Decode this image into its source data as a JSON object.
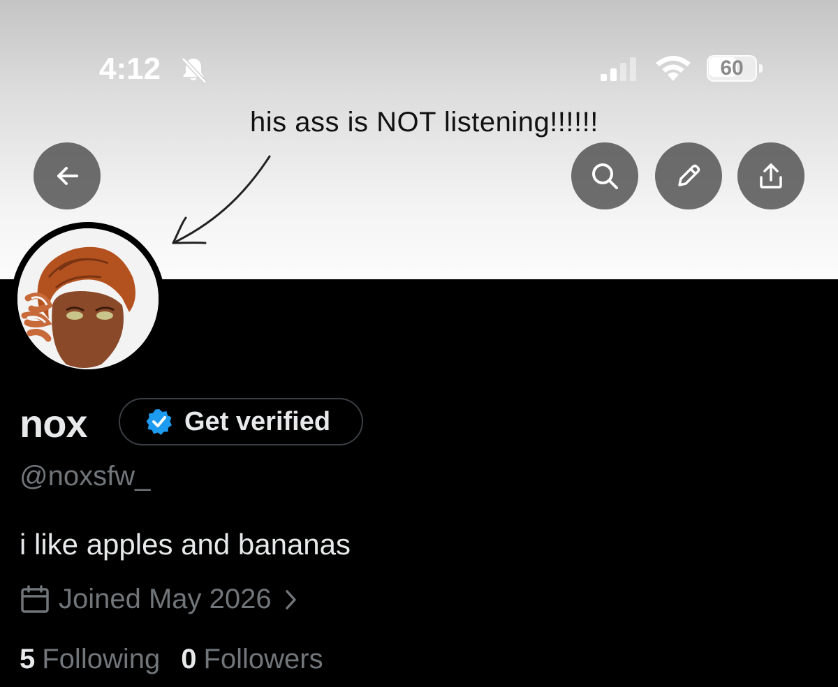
{
  "status_bar": {
    "time": "4:12",
    "battery_level": "60",
    "icons": [
      "bell-slash-icon",
      "cellular-signal-icon",
      "wifi-icon",
      "battery-icon"
    ]
  },
  "banner": {
    "caption": "his ass is NOT listening!!!!!!",
    "background": "#e6e6e6"
  },
  "header_buttons": {
    "back": "arrow-left-icon",
    "search": "search-icon",
    "edit": "pencil-icon",
    "share": "share-icon"
  },
  "profile": {
    "name": "nox",
    "verify_label": "Get verified",
    "handle": "@noxsfw_",
    "bio": "i like apples and bananas",
    "joined": "Joined May 2026",
    "following_count": "5",
    "following_label": "Following",
    "followers_count": "0",
    "followers_label": "Followers"
  },
  "colors": {
    "background": "#000000",
    "text_primary": "#e7e9ea",
    "text_secondary": "#71767b",
    "verified_blue": "#1d9bf0",
    "button_overlay": "#464646"
  }
}
